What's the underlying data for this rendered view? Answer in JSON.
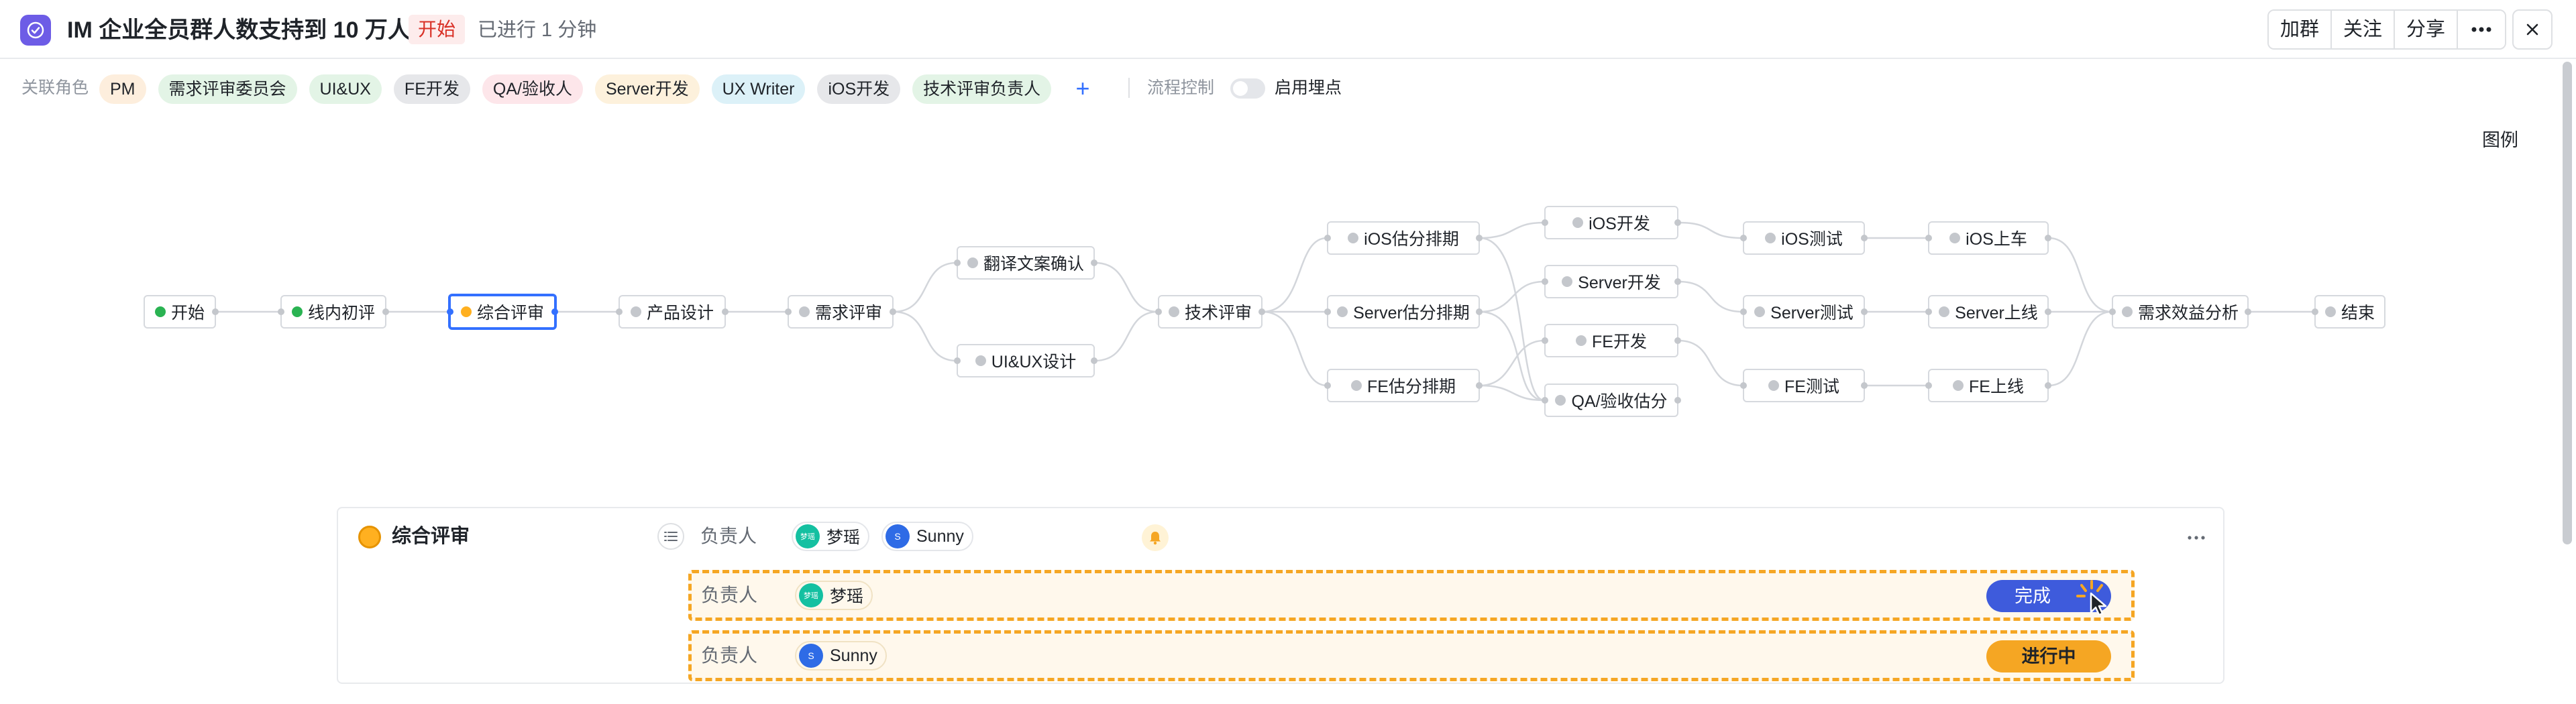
{
  "header": {
    "title": "IM 企业全员群人数支持到 10 万人",
    "status": "开始",
    "elapsed": "已进行 1 分钟",
    "buttons": {
      "join": "加群",
      "follow": "关注",
      "share": "分享"
    }
  },
  "roles": {
    "label": "关联角色",
    "chips": [
      {
        "label": "PM",
        "color": "#fdeedd"
      },
      {
        "label": "需求评审委员会",
        "color": "#e3f4e6"
      },
      {
        "label": "UI&UX",
        "color": "#e3f4e6"
      },
      {
        "label": "FE开发",
        "color": "#e6e7ea"
      },
      {
        "label": "QA/验收人",
        "color": "#fde6ea"
      },
      {
        "label": "Server开发",
        "color": "#fdf1dc"
      },
      {
        "label": "UX Writer",
        "color": "#dcf1f8"
      },
      {
        "label": "iOS开发",
        "color": "#e6e7ea"
      },
      {
        "label": "技术评审负责人",
        "color": "#e3f4e6"
      }
    ],
    "add": "+",
    "flow_control": "流程控制",
    "tracking": "启用埋点"
  },
  "legend": "图例",
  "flow": {
    "nodes": {
      "start": "开始",
      "line_review": "线内初评",
      "overall_review": "综合评审",
      "product_design": "产品设计",
      "req_review": "需求评审",
      "translation": "翻译文案确认",
      "uiux_design": "UI&UX设计",
      "tech_review": "技术评审",
      "ios_estimate": "iOS估分排期",
      "server_estimate": "Server估分排期",
      "fe_estimate": "FE估分排期",
      "ios_dev": "iOS开发",
      "server_dev": "Server开发",
      "fe_dev": "FE开发",
      "qa_estimate": "QA/验收估分",
      "ios_test": "iOS测试",
      "server_test": "Server测试",
      "fe_test": "FE测试",
      "ios_release": "iOS上车",
      "server_release": "Server上线",
      "fe_release": "FE上线",
      "benefit_analysis": "需求效益分析",
      "end": "结束"
    }
  },
  "panel": {
    "title": "综合评审",
    "owner_label": "负责人",
    "assignees": [
      {
        "name": "梦瑶",
        "avatar": "梦瑶"
      },
      {
        "name": "Sunny",
        "avatar": "S"
      }
    ],
    "rows": [
      {
        "owner_label": "负责人",
        "name": "梦瑶",
        "avatar": "梦瑶",
        "action": "完成"
      },
      {
        "owner_label": "负责人",
        "name": "Sunny",
        "avatar": "S",
        "action": "进行中"
      }
    ]
  }
}
